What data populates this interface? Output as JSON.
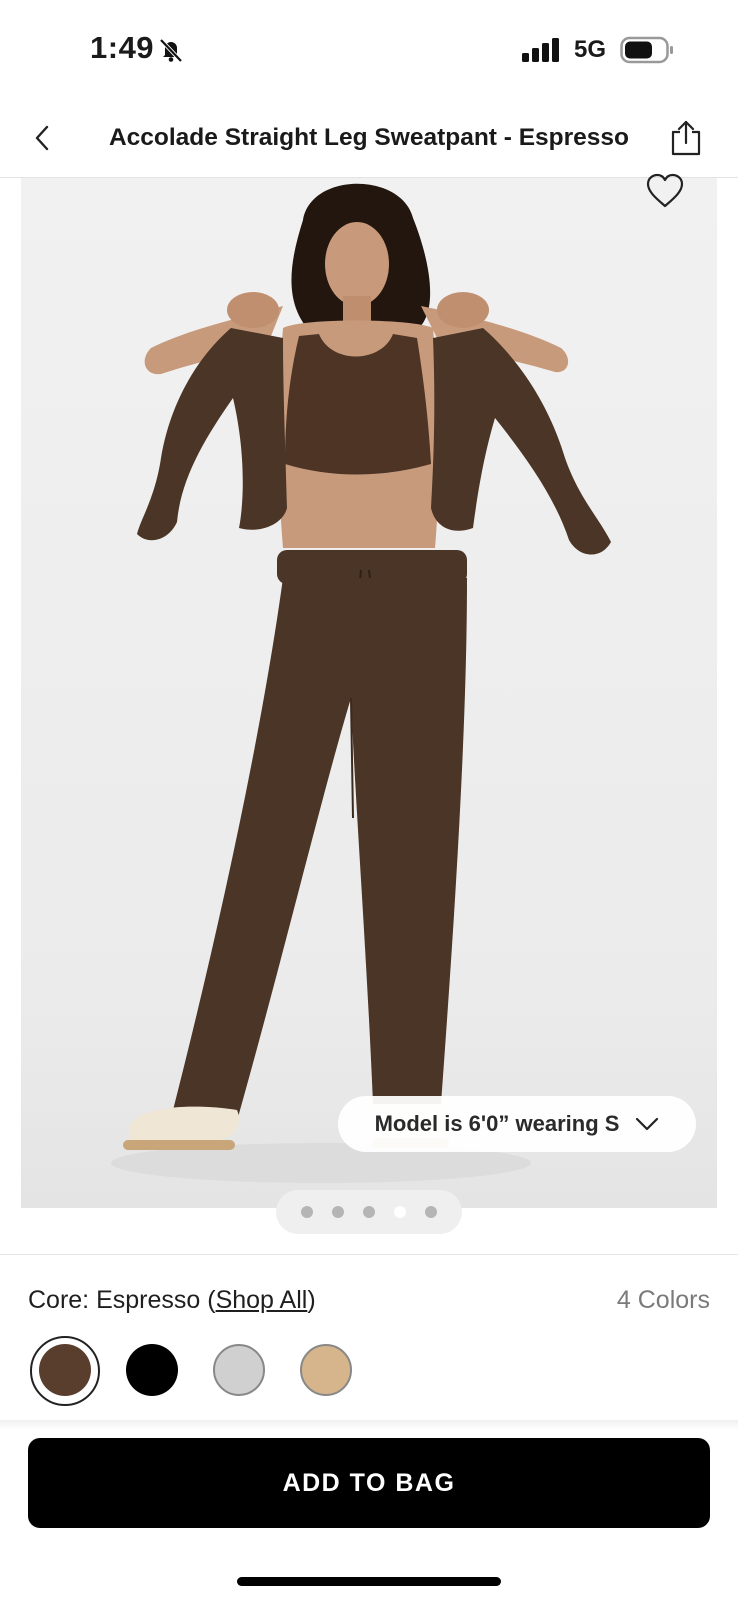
{
  "status_bar": {
    "time": "1:49",
    "network": "5G"
  },
  "header": {
    "title": "Accolade Straight Leg Sweatpant - Espresso"
  },
  "product_image": {
    "model_info": "Model is 6'0” wearing S",
    "carousel_total": 5,
    "carousel_active_index": 3
  },
  "color_section": {
    "collection_label": "Core: Espresso",
    "open_paren": " (",
    "shop_all_label": "Shop All",
    "close_paren": ")",
    "colors_count_label": "4 Colors",
    "selected_index": 0,
    "swatches": [
      {
        "name": "Espresso",
        "color": "#5a3e2d"
      },
      {
        "name": "Black",
        "color": "#000000"
      },
      {
        "name": "Grey",
        "color": "#d0d0d0"
      },
      {
        "name": "Tan",
        "color": "#d6b48c"
      }
    ]
  },
  "cta": {
    "add_to_bag_label": "ADD TO BAG"
  },
  "colors": {
    "product_brown": "#4a3526",
    "button_black": "#000000"
  }
}
